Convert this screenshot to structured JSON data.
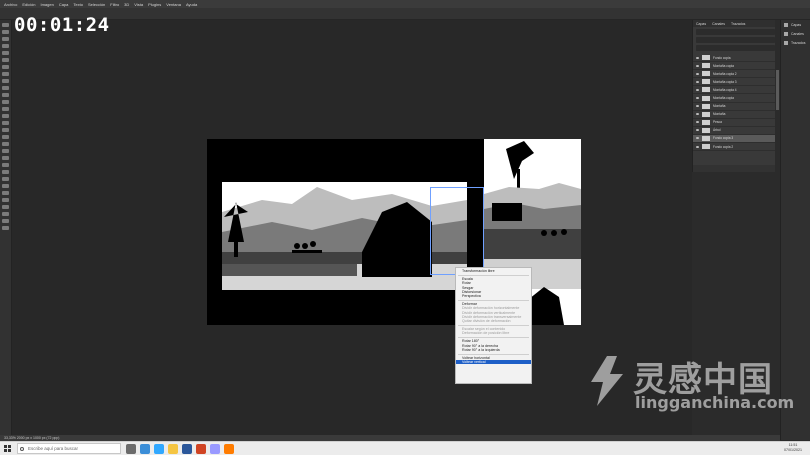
{
  "menubar": {
    "items": [
      "Archivo",
      "Edición",
      "Imagen",
      "Capa",
      "Texto",
      "Selección",
      "Filtro",
      "3D",
      "Vista",
      "Plugins",
      "Ventana",
      "Ayuda"
    ]
  },
  "timer": "00:01:24",
  "context_menu": {
    "groups": [
      [
        {
          "label": "Transformación libre",
          "enabled": true
        }
      ],
      [
        {
          "label": "Escala",
          "enabled": true
        },
        {
          "label": "Rotar",
          "enabled": true
        },
        {
          "label": "Sesgar",
          "enabled": true
        },
        {
          "label": "Distorsionar",
          "enabled": true
        },
        {
          "label": "Perspectiva",
          "enabled": true
        }
      ],
      [
        {
          "label": "Deformar",
          "enabled": true
        },
        {
          "label": "Dividir deformación horizontalmente",
          "enabled": false
        },
        {
          "label": "Dividir deformación verticalmente",
          "enabled": false
        },
        {
          "label": "Dividir deformación transversalmente",
          "enabled": false
        },
        {
          "label": "Quitar división de deformación",
          "enabled": false
        }
      ],
      [
        {
          "label": "Escalar según el contenido",
          "enabled": false
        },
        {
          "label": "Deformación de posición libre",
          "enabled": false
        }
      ],
      [
        {
          "label": "Rotar 180°",
          "enabled": true
        },
        {
          "label": "Rotar 90° a la derecha",
          "enabled": true
        },
        {
          "label": "Rotar 90° a la izquierda",
          "enabled": true
        }
      ],
      [
        {
          "label": "Voltear horizontal",
          "enabled": true
        },
        {
          "label": "Voltear vertical",
          "enabled": true,
          "selected": true
        }
      ]
    ]
  },
  "panel": {
    "tabs": [
      "Capas",
      "Canales",
      "Trazados"
    ],
    "layers": [
      {
        "name": "Fondo copia",
        "active": false
      },
      {
        "name": "Montaña copia",
        "active": false
      },
      {
        "name": "Montaña copia 2",
        "active": false
      },
      {
        "name": "Montaña copia 3",
        "active": false
      },
      {
        "name": "Montaña copia 4",
        "active": false
      },
      {
        "name": "Montaña copia",
        "active": false
      },
      {
        "name": "Montaña",
        "active": false
      },
      {
        "name": "Montaña",
        "active": false
      },
      {
        "name": "Pesca",
        "active": false
      },
      {
        "name": "Árbol",
        "active": false
      },
      {
        "name": "Fondo copia 3",
        "active": true
      },
      {
        "name": "Fondo copia 2",
        "active": false
      }
    ]
  },
  "side_panel": {
    "items": [
      "Capas",
      "Canales",
      "Trazados"
    ]
  },
  "statusbar": {
    "text": "33,33%   2000 px x 1000 px (72 ppp)"
  },
  "taskbar": {
    "search_placeholder": "Escribe aquí para buscar",
    "time": "11:51",
    "date": "07/01/2021"
  },
  "watermark": {
    "chinese": "灵感中国",
    "url": "lingganchina.com"
  },
  "colors": {
    "selection_blue": "#1e5fc7",
    "canvas_bg": "#282828",
    "transform_box": "#6fa0ff"
  }
}
